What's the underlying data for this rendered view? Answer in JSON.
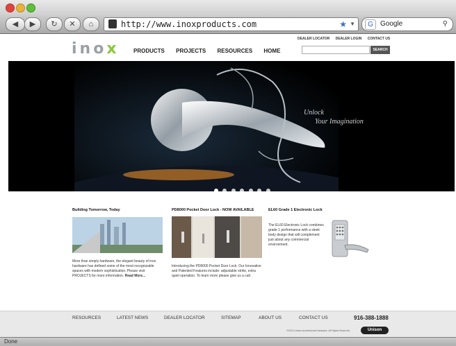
{
  "browser": {
    "url": "http://www.inoxproducts.com",
    "search_engine": "Google",
    "status": "Done"
  },
  "header": {
    "logo_text": "inox",
    "nav": [
      "PRODUCTS",
      "PROJECTS",
      "RESOURCES",
      "HOME"
    ],
    "util_links": [
      "DEALER LOCATOR",
      "DEALER LOGIN",
      "CONTACT US"
    ],
    "search_button": "SEARCH"
  },
  "hero": {
    "tagline_line1": "Unlock",
    "tagline_line2": "Your Imagination",
    "slide_count": 7,
    "active_slide": 1
  },
  "columns": [
    {
      "title": "Building Tomorrow, Today",
      "body": "More than simply hardware, the elegant beauty of inox hardware has defined some of the most recognizable spaces with modern sophistication. Please visit PROJECTS for more information.",
      "readmore": "Read More..."
    },
    {
      "title": "PD8000 Pocket Door Lock - NOW AVAILABLE",
      "body": "Introducing the PD8000 Pocket Door Lock. Our Innovative and Patented Features include: adjustable strike, extra quiet operation. To learn more please give us a call."
    },
    {
      "title": "EL60 Grade 1 Electronic Lock",
      "body": "The EL60 Electronic Lock combines grade 1 performance with a sleek body design that will complement just about any commercial environment."
    }
  ],
  "footer": {
    "links": [
      "RESOURCES",
      "LATEST NEWS",
      "DEALER LOCATOR",
      "SITEMAP",
      "ABOUT US",
      "CONTACT US"
    ],
    "phone": "916-388-1888",
    "copyright": "©2013 Unison Architectural Hardware, All Rights Reserved.",
    "brand": "Unison"
  },
  "colors": {
    "logo_gray": "#9aa0a4",
    "logo_green": "#8cc63f",
    "hero_bg": "#000000",
    "footer_bg": "#e9e9e9"
  }
}
